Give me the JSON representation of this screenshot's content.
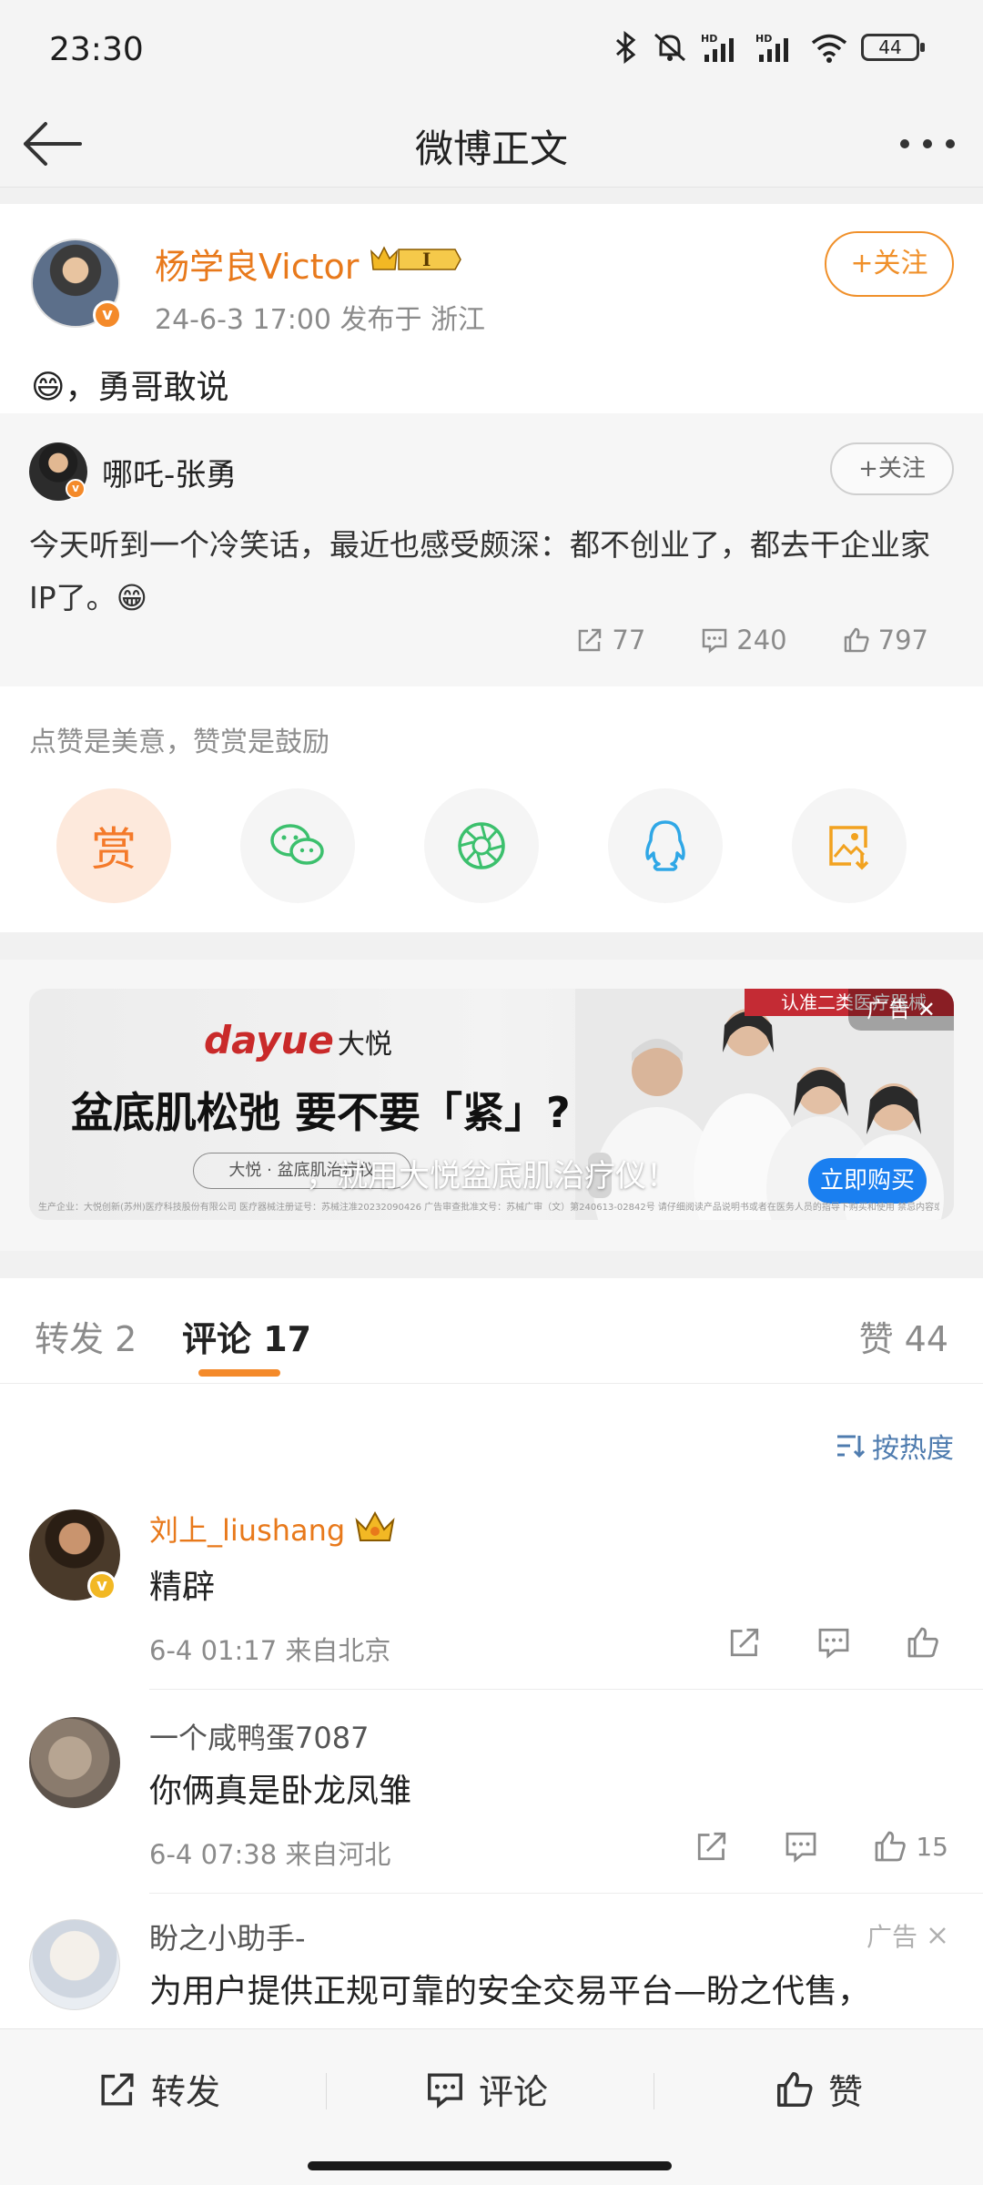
{
  "status_bar": {
    "time": "23:30",
    "battery": "44"
  },
  "nav": {
    "title": "微博正文"
  },
  "post": {
    "author": "杨学良Victor",
    "badge_text": "I",
    "meta": "24-6-3 17:00  发布于 浙江",
    "follow_label": "+关注",
    "text": "😄，勇哥敢说",
    "quote": {
      "author": "哪吒-张勇",
      "follow_label": "+关注",
      "text": "今天听到一个冷笑话，最近也感受颇深：都不创业了，都去干企业家IP了。😁",
      "reposts": "77",
      "comments": "240",
      "likes": "797"
    },
    "tip": "点赞是美意，赞赏是鼓励",
    "reward_label": "赏"
  },
  "ad_banner": {
    "brand": "dayue",
    "brand_cn": "大悦",
    "headline": "盆底肌松弛 要不要「紧」?",
    "subline": "，就用大悦盆底肌治疗仪！",
    "pill": "大悦 · 盆底肌治疗仪",
    "corner_red": "认准二类医疗器械",
    "ad_tag": "广告 ✕",
    "buy_label": "立即购买",
    "fine_print": "生产企业：大悦创新(苏州)医疗科技股份有限公司  医疗器械注册证号：苏械注准20232090426  广告审查批准文号：苏械广审（文）第240613-02842号  请仔细阅读产品说明书或者在医务人员的指导下购买和使用  禁忌内容或注意事项详见说明书"
  },
  "tabs": {
    "repost": "转发 2",
    "comment": "评论 17",
    "like": "赞 44"
  },
  "sort_label": "按热度",
  "comments": [
    {
      "name": "刘上_liushang",
      "text": "精辟",
      "meta": "6-4 01:17  来自北京",
      "likes": ""
    },
    {
      "name": "一个咸鸭蛋7087",
      "text": "你俩真是卧龙凤雏",
      "meta": "6-4 07:38  来自河北",
      "likes": "15"
    },
    {
      "name": "盼之小助手-",
      "text": "为用户提供正规可靠的安全交易平台—盼之代售，",
      "ad_label": "广告"
    }
  ],
  "bottom_bar": {
    "repost": "转发",
    "comment": "评论",
    "like": "赞"
  },
  "colors": {
    "accent": "#f48a2a",
    "link": "#4f7caf",
    "name_orange": "#e8791b"
  }
}
